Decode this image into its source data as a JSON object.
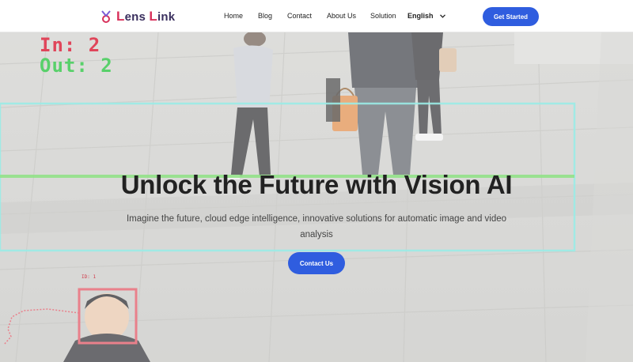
{
  "brand": {
    "name_a": "L",
    "name_b": "ens",
    "name_c": "L",
    "name_d": "ink"
  },
  "nav": {
    "links": [
      "Home",
      "Blog",
      "Contact",
      "About Us",
      "Solution"
    ],
    "language": "English",
    "cta_label": "Get Started"
  },
  "overlay": {
    "count_in": "In: 2",
    "count_out": "Out: 2",
    "detection_tag": "ID: 1"
  },
  "hero": {
    "title": "Unlock the Future with Vision AI",
    "subtitle": "Imagine the future, cloud edge intelligence, innovative solutions for automatic image and video analysis",
    "button_label": "Contact Us"
  },
  "colors": {
    "primary": "#2f5ddf",
    "logo_dark": "#3a2f5e",
    "logo_accent": "#d8315b",
    "line_cyan": "#6fe3dc",
    "line_green": "#5fd84f",
    "box_red": "#e04a5a"
  }
}
